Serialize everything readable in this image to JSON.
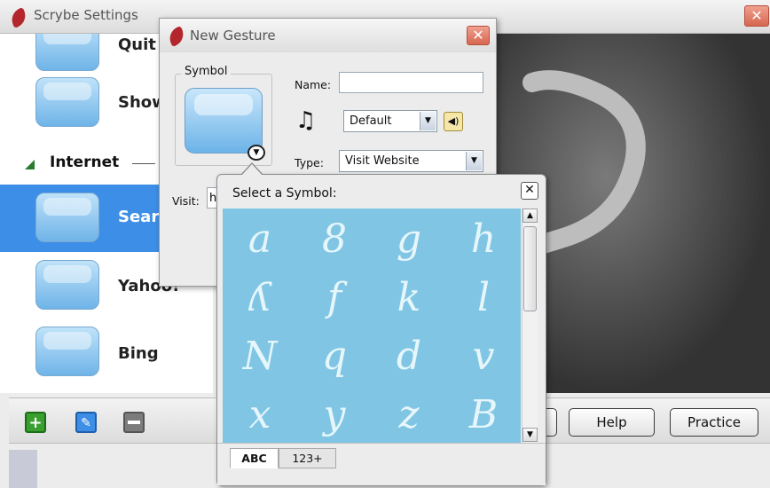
{
  "main_window": {
    "title": "Scrybe Settings",
    "close_glyph": "✕"
  },
  "gesture_list": {
    "items": [
      {
        "label": "Quit"
      },
      {
        "label": "Show"
      },
      {
        "label": "Search"
      },
      {
        "label": "Yahoo!"
      },
      {
        "label": "Bing"
      }
    ],
    "section": {
      "label": "Internet"
    }
  },
  "toolbar": {
    "add_icon": "plus-icon",
    "edit_icon": "wrench-icon",
    "remove_icon": "minus-icon",
    "help_label": "Help",
    "practice_label": "Practice"
  },
  "new_gesture_dialog": {
    "title": "New Gesture",
    "symbol_group_label": "Symbol",
    "name_label": "Name:",
    "name_value": "",
    "sound_value": "Default",
    "type_label": "Type:",
    "type_value": "Visit Website",
    "visit_label": "Visit:",
    "visit_value": "http"
  },
  "symbol_picker": {
    "title": "Select a Symbol:",
    "close_glyph": "✕",
    "symbols": [
      "a",
      "8",
      "g",
      "h",
      "ʎ",
      "f",
      "k",
      "l",
      "N",
      "q",
      "d",
      "v",
      "x",
      "y",
      "z",
      "B"
    ],
    "tabs": [
      "ABC",
      "123+"
    ],
    "active_tab": "ABC"
  },
  "colors": {
    "selection": "#3d8ee6",
    "symbol_grid_bg": "#80c6e4",
    "close_button": "#d6674f"
  }
}
